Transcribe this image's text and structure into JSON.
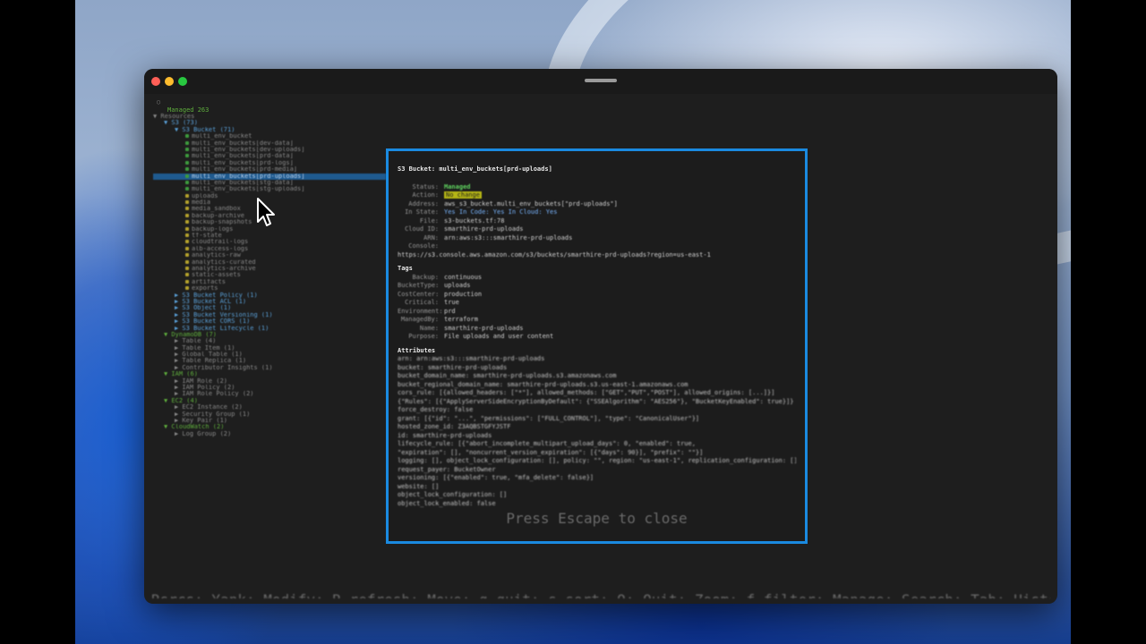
{
  "app": {
    "status_prompt": "○",
    "managed_label": "Managed 263",
    "footer_text": "Rsrcs: Yank: Modify: R refresh: Move: q quit: s sort: Q: Quit: Zoom: f filter: Manage: Search: Tab: History: Expand"
  },
  "tree": {
    "rows": [
      {
        "text": "▼ Resources",
        "indent": 0,
        "color": "#8a8a8a"
      },
      {
        "text": "▼ S3 (73)",
        "indent": 2,
        "color": "#5aa0d8"
      },
      {
        "text": "▼ S3 Bucket (71)",
        "indent": 4,
        "color": "#5aa0d8"
      },
      {
        "text": "multi_env_bucket",
        "indent": 6,
        "mark": "#3d9a3d"
      },
      {
        "text": "multi_env_buckets[dev-data]",
        "indent": 6,
        "mark": "#3d9a3d"
      },
      {
        "text": "multi_env_buckets[dev-uploads]",
        "indent": 6,
        "mark": "#3d9a3d"
      },
      {
        "text": "multi_env_buckets[prd-data]",
        "indent": 6,
        "mark": "#3d9a3d"
      },
      {
        "text": "multi_env_buckets[prd-logs]",
        "indent": 6,
        "mark": "#3d9a3d"
      },
      {
        "text": "multi_env_buckets[prd-media]",
        "indent": 6,
        "mark": "#3d9a3d"
      },
      {
        "text": "multi_env_buckets[prd-uploads]",
        "indent": 6,
        "mark": "#3d9a3d",
        "sel": true
      },
      {
        "text": "multi_env_buckets[stg-data]",
        "indent": 6,
        "mark": "#3d9a3d"
      },
      {
        "text": "multi_env_buckets[stg-uploads]",
        "indent": 6,
        "mark": "#3d9a3d"
      },
      {
        "text": "uploads",
        "indent": 6,
        "mark": "#b5a22c"
      },
      {
        "text": "media",
        "indent": 6,
        "mark": "#b5a22c"
      },
      {
        "text": "media_sandbox",
        "indent": 6,
        "mark": "#b5a22c"
      },
      {
        "text": "backup-archive",
        "indent": 6,
        "mark": "#b5a22c"
      },
      {
        "text": "backup-snapshots",
        "indent": 6,
        "mark": "#b5a22c"
      },
      {
        "text": "backup-logs",
        "indent": 6,
        "mark": "#b5a22c"
      },
      {
        "text": "tf-state",
        "indent": 6,
        "mark": "#b5a22c"
      },
      {
        "text": "cloudtrail-logs",
        "indent": 6,
        "mark": "#b5a22c"
      },
      {
        "text": "alb-access-logs",
        "indent": 6,
        "mark": "#b5a22c"
      },
      {
        "text": "analytics-raw",
        "indent": 6,
        "mark": "#b5a22c"
      },
      {
        "text": "analytics-curated",
        "indent": 6,
        "mark": "#b5a22c"
      },
      {
        "text": "analytics-archive",
        "indent": 6,
        "mark": "#b5a22c"
      },
      {
        "text": "static-assets",
        "indent": 6,
        "mark": "#b5a22c"
      },
      {
        "text": "artifacts",
        "indent": 6,
        "mark": "#b5a22c"
      },
      {
        "text": "exports",
        "indent": 6,
        "mark": "#b5a22c"
      },
      {
        "text": "▶ S3 Bucket Policy (1)",
        "indent": 4,
        "color": "#5aa0d8"
      },
      {
        "text": "▶ S3 Bucket ACL (1)",
        "indent": 4,
        "color": "#5aa0d8"
      },
      {
        "text": "▶ S3 Object (1)",
        "indent": 4,
        "color": "#5aa0d8"
      },
      {
        "text": "▶ S3 Bucket Versioning (1)",
        "indent": 4,
        "color": "#5aa0d8"
      },
      {
        "text": "▶ S3 Bucket CORS (1)",
        "indent": 4,
        "color": "#5aa0d8"
      },
      {
        "text": "▶ S3 Bucket Lifecycle (1)",
        "indent": 4,
        "color": "#5aa0d8"
      },
      {
        "text": "▼ DynamoDB (7)",
        "indent": 2,
        "color": "#5fae3d"
      },
      {
        "text": "▶ Table (4)",
        "indent": 4,
        "color": "#8a8a8a"
      },
      {
        "text": "▶ Table Item (1)",
        "indent": 4,
        "color": "#8a8a8a"
      },
      {
        "text": "▶ Global Table (1)",
        "indent": 4,
        "color": "#8a8a8a"
      },
      {
        "text": "▶ Table Replica (1)",
        "indent": 4,
        "color": "#8a8a8a"
      },
      {
        "text": "▶ Contributor Insights (1)",
        "indent": 4,
        "color": "#8a8a8a"
      },
      {
        "text": "▼ IAM (6)",
        "indent": 2,
        "color": "#5fae3d"
      },
      {
        "text": "▶ IAM Role (2)",
        "indent": 4,
        "color": "#8a8a8a"
      },
      {
        "text": "▶ IAM Policy (2)",
        "indent": 4,
        "color": "#8a8a8a"
      },
      {
        "text": "▶ IAM Role Policy (2)",
        "indent": 4,
        "color": "#8a8a8a"
      },
      {
        "text": "▼ EC2 (4)",
        "indent": 2,
        "color": "#5fae3d"
      },
      {
        "text": "▶ EC2 Instance (2)",
        "indent": 4,
        "color": "#8a8a8a"
      },
      {
        "text": "▶ Security Group (1)",
        "indent": 4,
        "color": "#8a8a8a"
      },
      {
        "text": "▶ Key Pair (1)",
        "indent": 4,
        "color": "#8a8a8a"
      },
      {
        "text": "▼ CloudWatch (2)",
        "indent": 2,
        "color": "#5fae3d"
      },
      {
        "text": "▶ Log Group (2)",
        "indent": 4,
        "color": "#8a8a8a"
      }
    ]
  },
  "popup": {
    "title": "S3 Bucket: multi_env_buckets[prd-uploads]",
    "fields": [
      {
        "key": "Status:",
        "value": "Managed",
        "style": "green"
      },
      {
        "key": "Action:",
        "value": "No change",
        "style": "yellowbg"
      },
      {
        "key": "Address:",
        "value": "aws_s3_bucket.multi_env_buckets[\"prd-uploads\"]",
        "style": ""
      },
      {
        "key": "In State:",
        "value": "Yes  In Code: Yes  In Cloud: Yes",
        "style": "blue"
      },
      {
        "key": "File:",
        "value": "s3-buckets.tf:78",
        "style": ""
      },
      {
        "key": "Cloud ID:",
        "value": "smarthire-prd-uploads",
        "style": ""
      },
      {
        "key": "ARN:",
        "value": "arn:aws:s3:::smarthire-prd-uploads",
        "style": ""
      },
      {
        "key": "Console:",
        "value": "",
        "style": ""
      }
    ],
    "console_url": "https://s3.console.aws.amazon.com/s3/buckets/smarthire-prd-uploads?region=us-east-1",
    "tags_heading": "Tags",
    "tags": [
      {
        "key": "Backup:",
        "value": "continuous"
      },
      {
        "key": "BucketType:",
        "value": "uploads"
      },
      {
        "key": "CostCenter:",
        "value": "production"
      },
      {
        "key": "Critical:",
        "value": "true"
      },
      {
        "key": "Environment:",
        "value": "prd"
      },
      {
        "key": "ManagedBy:",
        "value": "terraform"
      },
      {
        "key": "Name:",
        "value": "smarthire-prd-uploads"
      },
      {
        "key": "Purpose:",
        "value": "File uploads and user content"
      }
    ],
    "attributes_heading": "Attributes",
    "attributes": [
      "arn: arn:aws:s3:::smarthire-prd-uploads",
      "bucket: smarthire-prd-uploads",
      "bucket_domain_name: smarthire-prd-uploads.s3.amazonaws.com",
      "bucket_regional_domain_name: smarthire-prd-uploads.s3.us-east-1.amazonaws.com",
      "cors_rule: [{allowed_headers: [\"*\"], allowed_methods: [\"GET\",\"PUT\",\"POST\"], allowed_origins: [...]}]",
      "{\"Rules\": [{\"ApplyServerSideEncryptionByDefault\": {\"SSEAlgorithm\": \"AES256\"}, \"BucketKeyEnabled\": true}]}",
      "force_destroy: false",
      "grant: [{\"id\": \"...\", \"permissions\": [\"FULL_CONTROL\"], \"type\": \"CanonicalUser\"}]",
      "hosted_zone_id: Z3AQBSTGFYJSTF",
      "id: smarthire-prd-uploads",
      "lifecycle_rule: [{\"abort_incomplete_multipart_upload_days\": 0, \"enabled\": true,",
      "\"expiration\": [], \"noncurrent_version_expiration\": [{\"days\": 90}], \"prefix\": \"\"}]",
      "logging: [], object_lock_configuration: [], policy: \"\", region: \"us-east-1\", replication_configuration: []",
      "request_payer: BucketOwner",
      "versioning: [{\"enabled\": true, \"mfa_delete\": false}]",
      "website: []",
      "object_lock_configuration: []",
      "object_lock_enabled: false"
    ],
    "footer": "Press Escape to close"
  }
}
